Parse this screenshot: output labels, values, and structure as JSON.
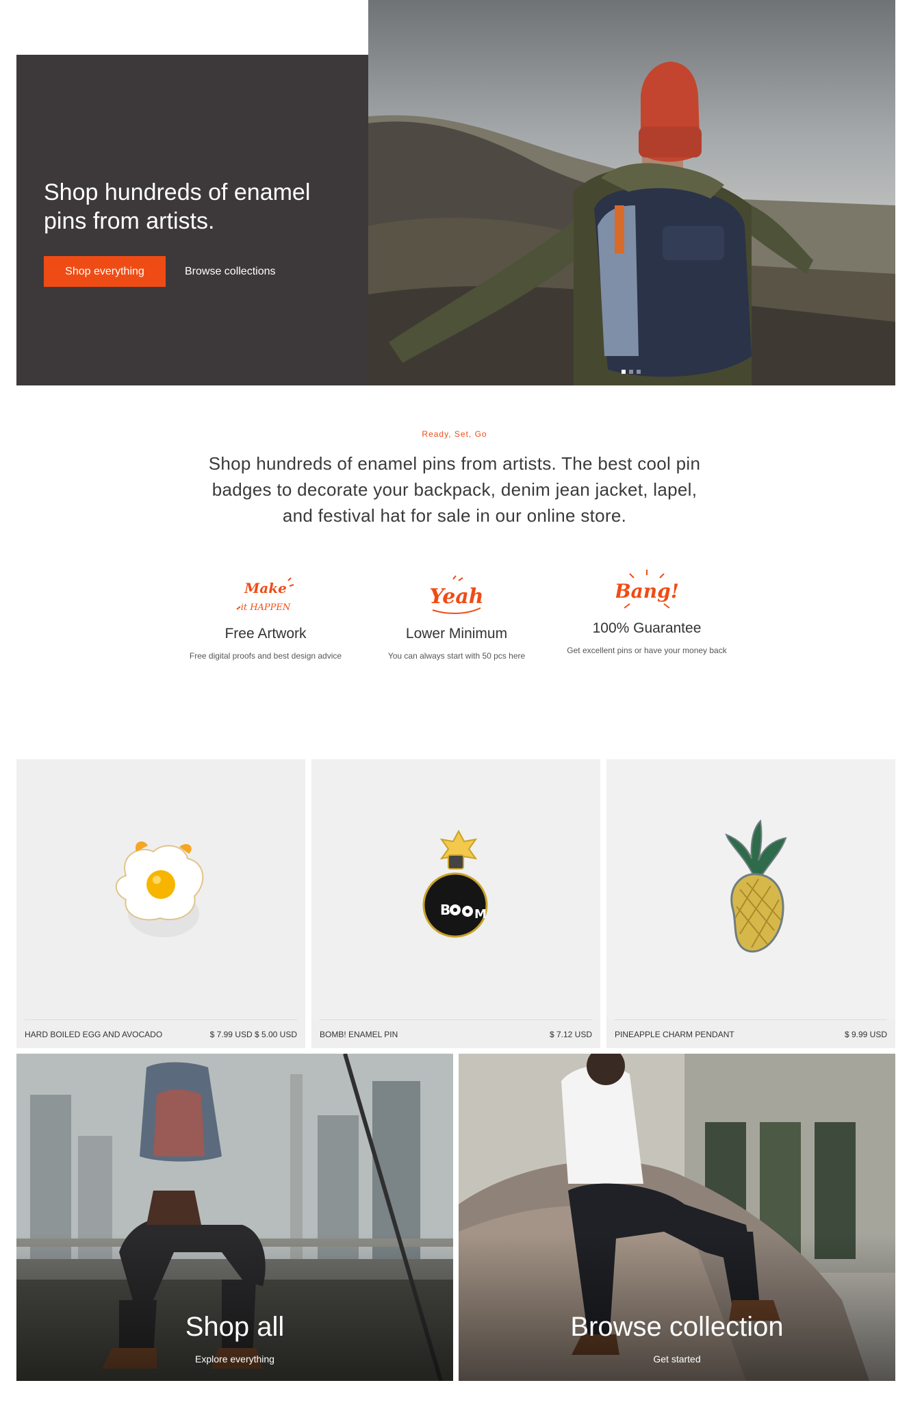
{
  "hero": {
    "title": "Shop hundreds of enamel pins from artists.",
    "primary_button": "Shop everything",
    "secondary_link": "Browse collections",
    "slide_count": 3,
    "active_slide": 1
  },
  "intro": {
    "eyebrow": "Ready, Set, Go",
    "text": "Shop hundreds of enamel pins from artists. The best cool pin badges to decorate your backpack, denim jean jacket, lapel, and festival hat for sale in our online store."
  },
  "features": [
    {
      "art": "Make it HAPPEN",
      "title": "Free Artwork",
      "desc": "Free digital proofs and best design advice"
    },
    {
      "art": "Yeah",
      "title": "Lower Minimum",
      "desc": "You can always start with 50 pcs here"
    },
    {
      "art": "Bang!",
      "title": "100% Guarantee",
      "desc": "Get excellent pins or have your money back"
    }
  ],
  "products": [
    {
      "name": "HARD BOILED EGG AND AVOCADO",
      "price": "$ 7.99 USD $ 5.00 USD"
    },
    {
      "name": "BOMB! ENAMEL PIN",
      "price": "$ 7.12 USD"
    },
    {
      "name": "PINEAPPLE CHARM PENDANT",
      "price": "$ 9.99 USD"
    }
  ],
  "promos": [
    {
      "title": "Shop all",
      "subtitle": "Explore everything"
    },
    {
      "title": "Browse collection",
      "subtitle": "Get started"
    }
  ],
  "colors": {
    "accent": "#ef4c15",
    "hero_panel": "#3d393a",
    "card_bg": "#efefef"
  }
}
